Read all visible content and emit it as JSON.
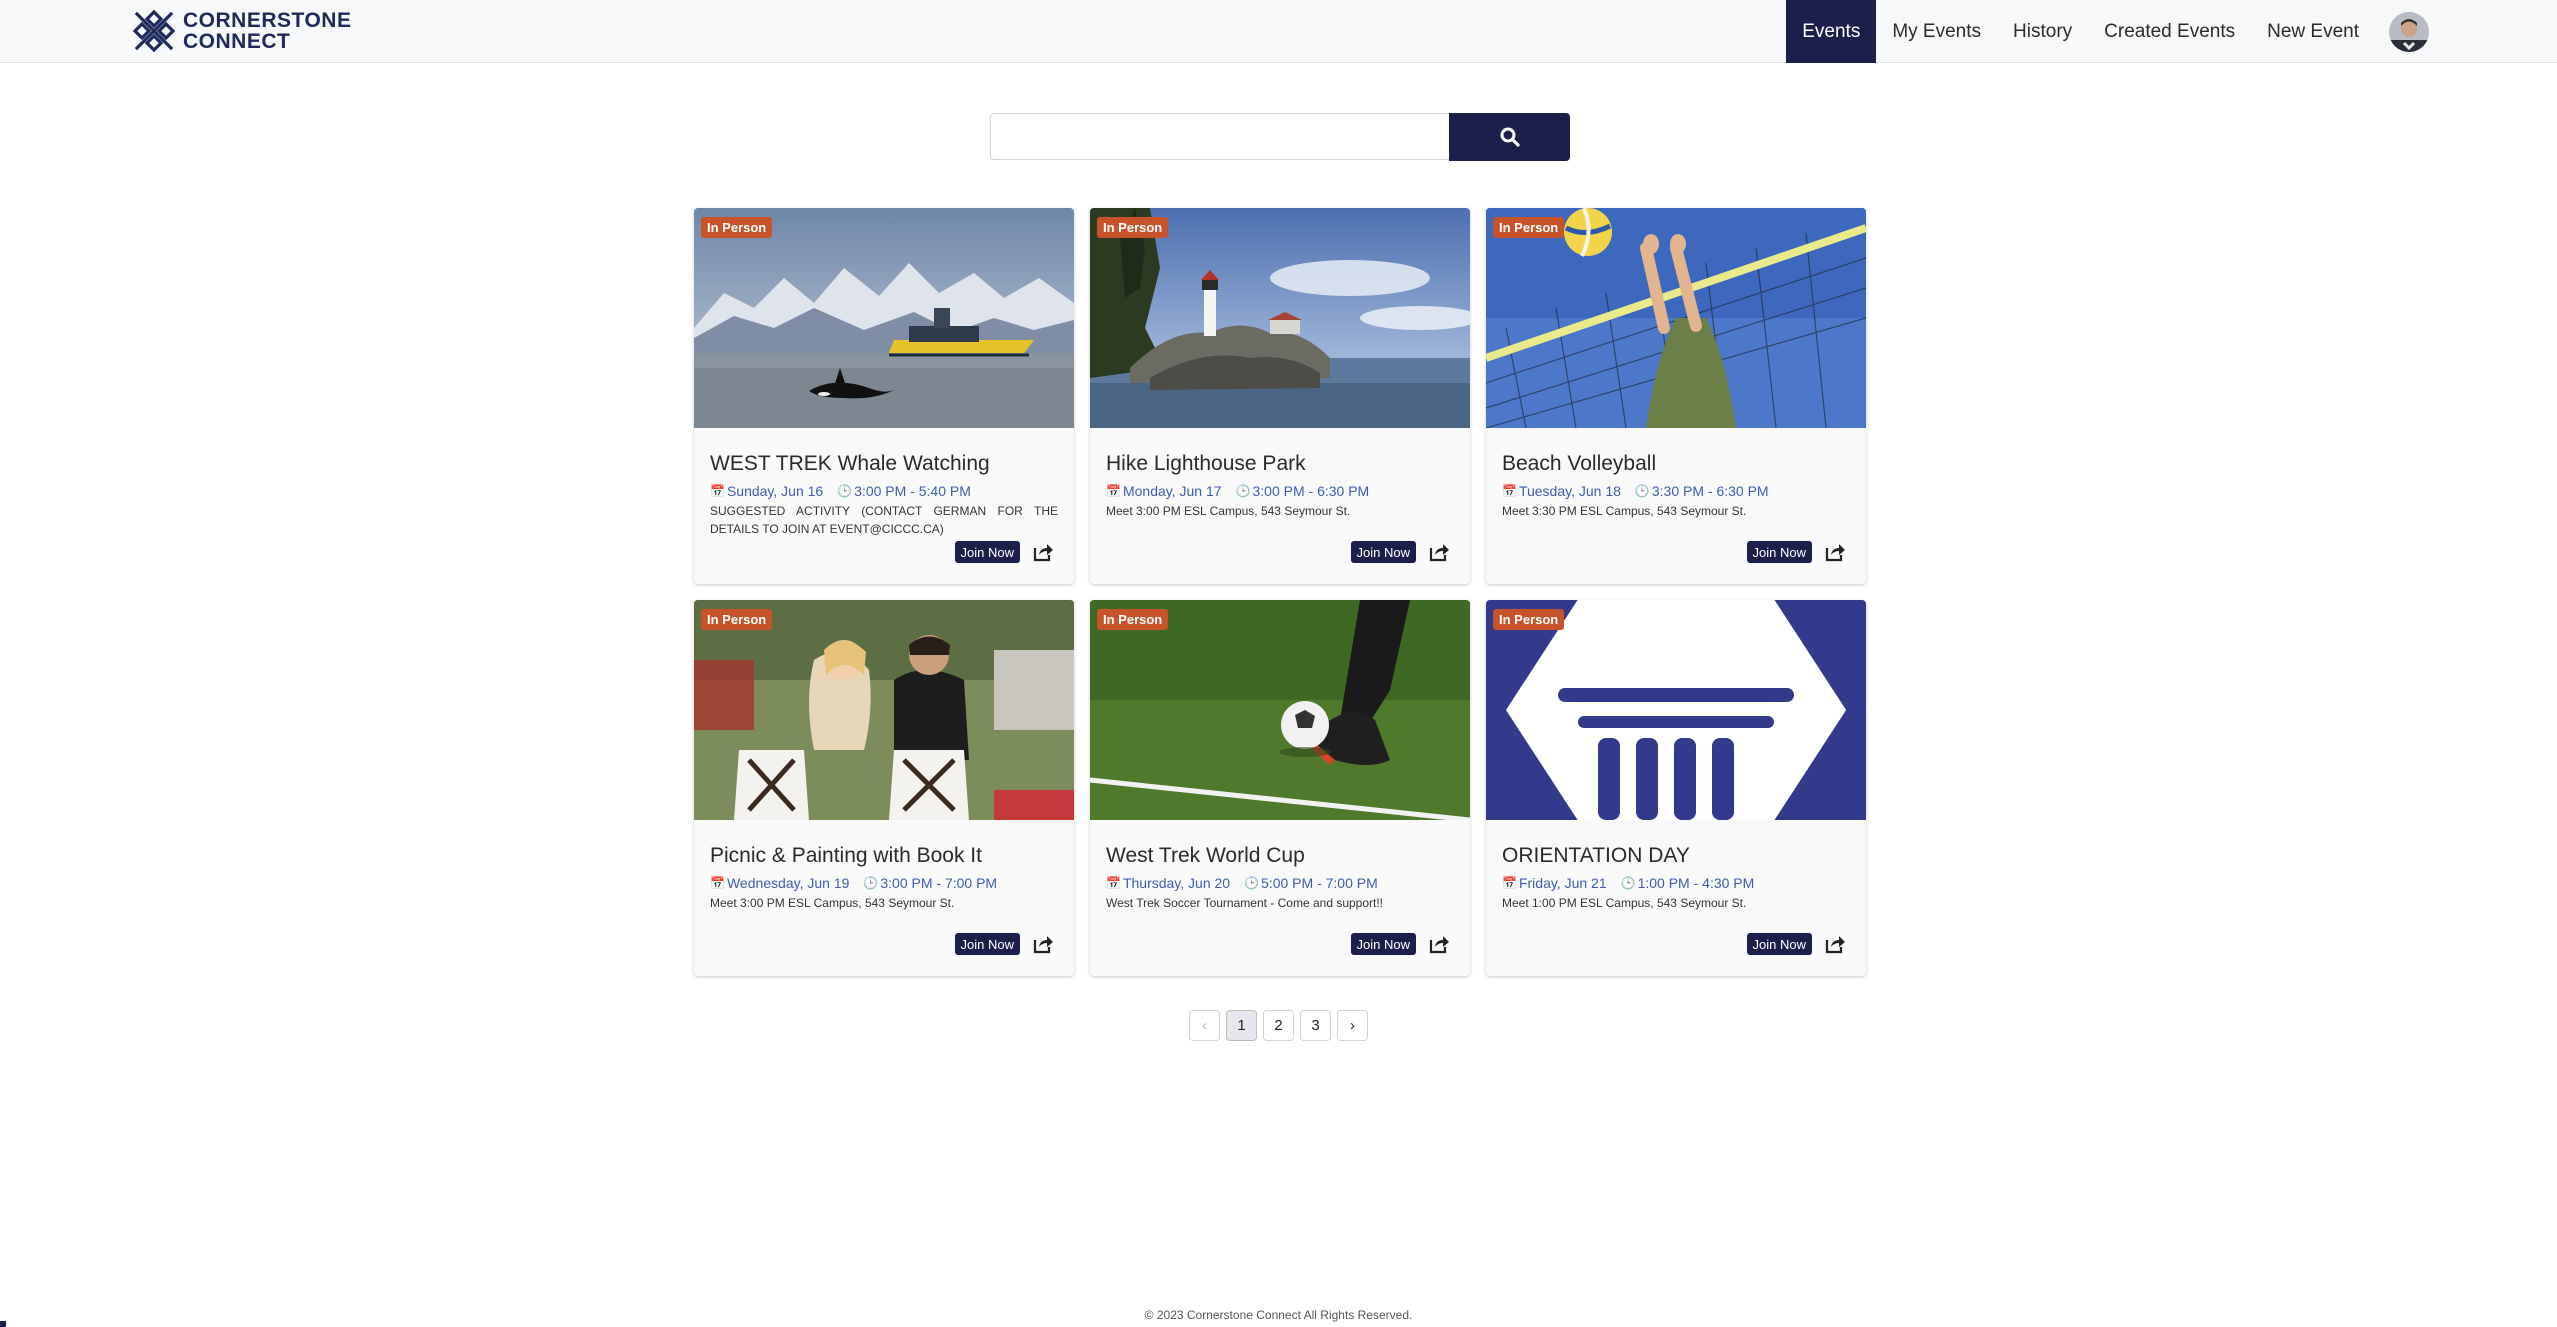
{
  "brand": {
    "line1": "CORNERSTONE",
    "line2": "CONNECT"
  },
  "nav": {
    "items": [
      "Events",
      "My Events",
      "History",
      "Created Events",
      "New Event"
    ],
    "active": "Events"
  },
  "search": {
    "value": "",
    "placeholder": ""
  },
  "events": [
    {
      "badge": "In Person",
      "title": "WEST TREK Whale Watching",
      "date": "Sunday, Jun 16",
      "time": "3:00 PM - 5:40 PM",
      "desc_line1": "SUGGESTED ACTIVITY (CONTACT GERMAN FOR THE",
      "desc_line2": "DETAILS TO JOIN AT EVENT@CICCC.CA)",
      "join_label": "Join Now",
      "image": "whale-boat-mountains"
    },
    {
      "badge": "In Person",
      "title": "Hike Lighthouse Park",
      "date": "Monday, Jun 17",
      "time": "3:00 PM - 6:30 PM",
      "desc": "Meet 3:00 PM ESL Campus, 543 Seymour St.",
      "join_label": "Join Now",
      "image": "lighthouse-rocks"
    },
    {
      "badge": "In Person",
      "title": "Beach Volleyball",
      "date": "Tuesday, Jun 18",
      "time": "3:30 PM - 6:30 PM",
      "desc": "Meet 3:30 PM ESL Campus, 543 Seymour St.",
      "join_label": "Join Now",
      "image": "volleyball-net"
    },
    {
      "badge": "In Person",
      "title": "Picnic & Painting with Book It",
      "date": "Wednesday, Jun 19",
      "time": "3:00 PM - 7:00 PM",
      "desc": "Meet 3:00 PM ESL Campus, 543 Seymour St.",
      "join_label": "Join Now",
      "image": "picnic-painting"
    },
    {
      "badge": "In Person",
      "title": "West Trek World Cup",
      "date": "Thursday, Jun 20",
      "time": "5:00 PM - 7:00 PM",
      "desc": "West Trek Soccer Tournament - Come and support!!",
      "join_label": "Join Now",
      "image": "soccer-kick"
    },
    {
      "badge": "In Person",
      "title": "ORIENTATION DAY",
      "date": "Friday, Jun 21",
      "time": "1:00 PM - 4:30 PM",
      "desc": "Meet 1:00 PM ESL Campus, 543 Seymour St.",
      "join_label": "Join Now",
      "image": "pillar-logo"
    }
  ],
  "pagination": {
    "prev": "‹",
    "pages": [
      "1",
      "2",
      "3"
    ],
    "current": "1",
    "next": "›"
  },
  "footer": "© 2023 Cornerstone Connect All Rights Reserved.",
  "colors": {
    "primary": "#1d1f4b",
    "badge": "#c8532a",
    "meta": "#3d5dac",
    "pillar_bg": "#333a8c"
  }
}
